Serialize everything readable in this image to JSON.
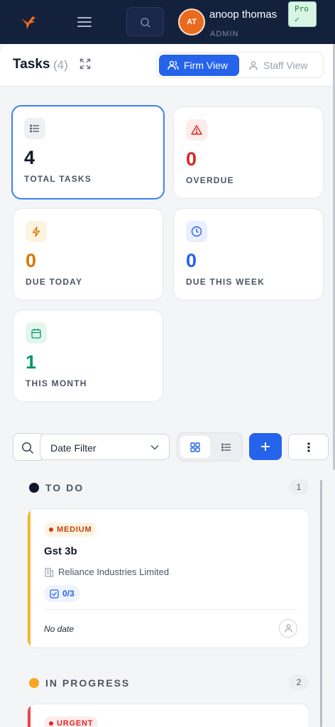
{
  "nav": {
    "avatar_initials": "AT",
    "user_name": "anoop thomas",
    "user_role": "ADMIN",
    "plan_badge": "Pro",
    "plan_check": "✓"
  },
  "header": {
    "title": "Tasks",
    "count": "(4)",
    "firm_view_label": "Firm View",
    "staff_view_label": "Staff View"
  },
  "stats": [
    {
      "value": "4",
      "label": "TOTAL TASKS",
      "color": "#111827"
    },
    {
      "value": "0",
      "label": "OVERDUE",
      "color": "#dc2626"
    },
    {
      "value": "0",
      "label": "DUE TODAY",
      "color": "#d97706"
    },
    {
      "value": "0",
      "label": "DUE THIS WEEK",
      "color": "#2563eb"
    },
    {
      "value": "1",
      "label": "THIS MONTH",
      "color": "#059669"
    }
  ],
  "toolbar": {
    "date_filter_label": "Date Filter"
  },
  "columns": [
    {
      "name": "TO DO",
      "count": "1",
      "dot_color": "#111827",
      "tasks": [
        {
          "priority": "MEDIUM",
          "priority_color": "#d97706",
          "title": "Gst 3b",
          "client": "Reliance Industries Limited",
          "subtasks": "0/3",
          "due": "No date"
        }
      ]
    },
    {
      "name": "IN PROGRESS",
      "count": "2",
      "dot_color": "#f59e0b",
      "tasks": [
        {
          "priority": "URGENT",
          "priority_color": "#dc2626"
        }
      ]
    }
  ]
}
